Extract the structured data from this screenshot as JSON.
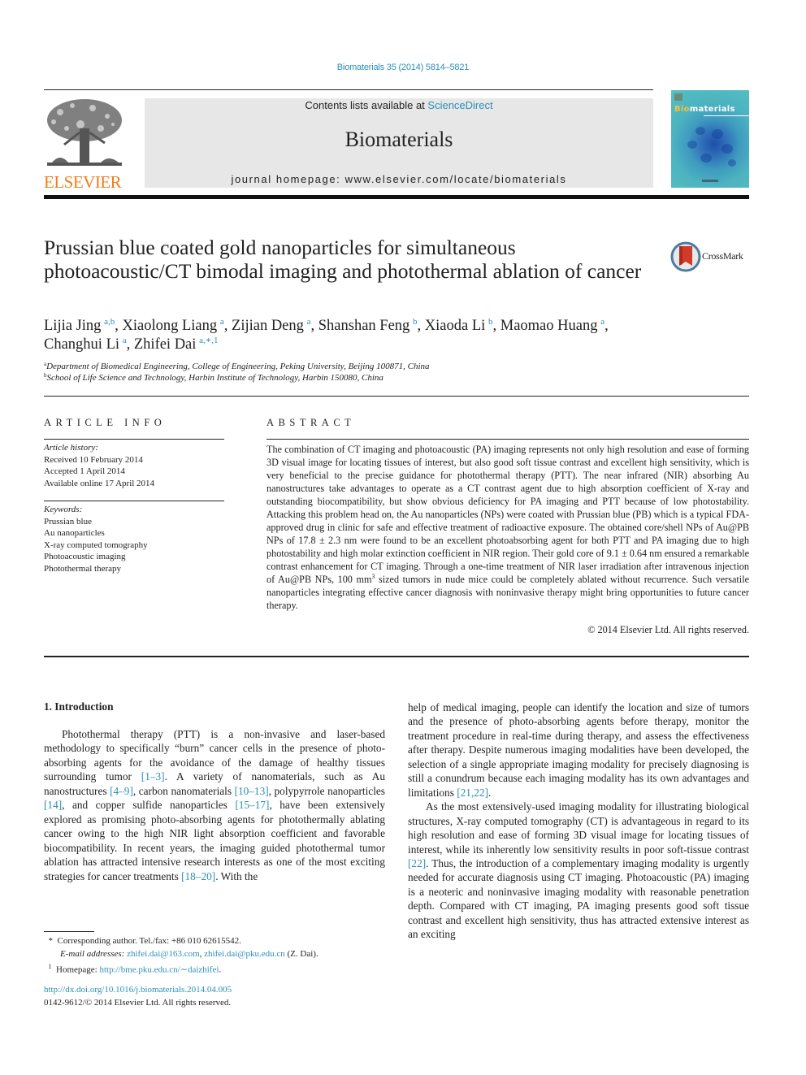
{
  "header": {
    "citation": "Biomaterials 35 (2014) 5814–5821",
    "contents_prefix": "Contents lists available at ",
    "contents_link": "ScienceDirect",
    "journal_name": "Biomaterials",
    "homepage": "journal homepage: www.elsevier.com/locate/biomaterials",
    "publisher_wordmark": "ELSEVIER",
    "cover_title_accent": "Bio",
    "cover_title_rest": "materials",
    "crossmark_label": "CrossMark"
  },
  "article": {
    "title": "Prussian blue coated gold nanoparticles for simultaneous photoacoustic/CT bimodal imaging and photothermal ablation of cancer",
    "authors": [
      {
        "name": "Lijia Jing",
        "sup": "a,b",
        "sep": ", "
      },
      {
        "name": "Xiaolong Liang",
        "sup": "a",
        "sep": ", "
      },
      {
        "name": "Zijian Deng",
        "sup": "a",
        "sep": ", "
      },
      {
        "name": "Shanshan Feng",
        "sup": "b",
        "sep": ", "
      },
      {
        "name": "Xiaoda Li",
        "sup": "b",
        "sep": ", "
      },
      {
        "name": "Maomao Huang",
        "sup": "a",
        "sep": ","
      },
      {
        "name": "Changhui Li",
        "sup": "a",
        "sep": ", "
      },
      {
        "name": "Zhifei Dai",
        "sup": "a,∗,1",
        "sep": ""
      }
    ],
    "affiliations": [
      {
        "mark": "a",
        "text": "Department of Biomedical Engineering, College of Engineering, Peking University, Beijing 100871, China"
      },
      {
        "mark": "b",
        "text": "School of Life Science and Technology, Harbin Institute of Technology, Harbin 150080, China"
      }
    ]
  },
  "article_info": {
    "heading": "ARTICLE INFO",
    "history_label": "Article history:",
    "history": [
      "Received 10 February 2014",
      "Accepted 1 April 2014",
      "Available online 17 April 2014"
    ],
    "keywords_label": "Keywords:",
    "keywords": [
      "Prussian blue",
      "Au nanoparticles",
      "X-ray computed tomography",
      "Photoacoustic imaging",
      "Photothermal therapy"
    ]
  },
  "abstract": {
    "heading": "ABSTRACT",
    "text_before_sup": "The combination of CT imaging and photoacoustic (PA) imaging represents not only high resolution and ease of forming 3D visual image for locating tissues of interest, but also good soft tissue contrast and excellent high sensitivity, which is very beneficial to the precise guidance for photothermal therapy (PTT). The near infrared (NIR) absorbing Au nanostructures take advantages to operate as a CT contrast agent due to high absorption coefficient of X-ray and outstanding biocompatibility, but show obvious deficiency for PA imaging and PTT because of low photostability. Attacking this problem head on, the Au nanoparticles (NPs) were coated with Prussian blue (PB) which is a typical FDA-approved drug in clinic for safe and effective treatment of radioactive exposure. The obtained core/shell NPs of Au@PB NPs of 17.8 ± 2.3 nm were found to be an excellent photoabsorbing agent for both PTT and PA imaging due to high photostability and high molar extinction coefficient in NIR region. Their gold core of 9.1 ± 0.64 nm ensured a remarkable contrast enhancement for CT imaging. Through a one-time treatment of NIR laser irradiation after intravenous injection of Au@PB NPs, 100 mm",
    "sup": "3",
    "text_after_sup": " sized tumors in nude mice could be completely ablated without recurrence. Such versatile nanoparticles integrating effective cancer diagnosis with noninvasive therapy might bring opportunities to future cancer therapy.",
    "copyright": "© 2014 Elsevier Ltd. All rights reserved."
  },
  "introduction": {
    "heading": "1.  Introduction",
    "left_para": [
      {
        "t": "Photothermal therapy (PTT) is a non-invasive and laser-based methodology to specifically “burn” cancer cells in the presence of photo-absorbing agents for the avoidance of the damage of healthy tissues surrounding tumor "
      },
      {
        "ref": "[1–3]"
      },
      {
        "t": ". A variety of nanomaterials, such as Au nanostructures "
      },
      {
        "ref": "[4–9]"
      },
      {
        "t": ", carbon nanomaterials "
      },
      {
        "ref": "[10–13]"
      },
      {
        "t": ", polypyrrole nanoparticles "
      },
      {
        "ref": "[14]"
      },
      {
        "t": ", and copper sulfide nanoparticles "
      },
      {
        "ref": "[15–17]"
      },
      {
        "t": ", have been extensively explored as promising photo-absorbing agents for photothermally ablating cancer owing to the high NIR light absorption coefficient and favorable biocompatibility. In recent years, the imaging guided photothermal tumor ablation has attracted intensive research interests as one of the most exciting strategies for cancer treatments "
      },
      {
        "ref": "[18–20]"
      },
      {
        "t": ". With the"
      }
    ],
    "right_para1": [
      {
        "t": "help of medical imaging, people can identify the location and size of tumors and the presence of photo-absorbing agents before therapy, monitor the treatment procedure in real-time during therapy, and assess the effectiveness after therapy. Despite numerous imaging modalities have been developed, the selection of a single appropriate imaging modality for precisely diagnosing is still a conundrum because each imaging modality has its own advantages and limitations "
      },
      {
        "ref": "[21,22]"
      },
      {
        "t": "."
      }
    ],
    "right_para2": [
      {
        "t": "As the most extensively-used imaging modality for illustrating biological structures, X-ray computed tomography (CT) is advantageous in regard to its high resolution and ease of forming 3D visual image for locating tissues of interest, while its inherently low sensitivity results in poor soft-tissue contrast "
      },
      {
        "ref": "[22]"
      },
      {
        "t": ". Thus, the introduction of a complementary imaging modality is urgently needed for accurate diagnosis using CT imaging. Photoacoustic (PA) imaging is a neoteric and noninvasive imaging modality with reasonable penetration depth. Compared with CT imaging, PA imaging presents good soft tissue contrast and excellent high sensitivity, thus has attracted extensive interest as an exciting"
      }
    ]
  },
  "footnotes": {
    "corresponding_mark": "*",
    "corresponding": "Corresponding author. Tel./fax: +86 010 62615542.",
    "email_label": "E-mail addresses:",
    "email1": "zhifei.dai@163.com",
    "email2": "zhifei.dai@pku.edu.cn",
    "email_suffix": " (Z. Dai).",
    "homepage_mark": "1",
    "homepage_label": "Homepage: ",
    "homepage_url": "http://bme.pku.edu.cn/∼daizhifei",
    "homepage_suffix": "."
  },
  "doi": {
    "url": "http://dx.doi.org/10.1016/j.biomaterials.2014.04.005",
    "issn_line": "0142-9612/© 2014 Elsevier Ltd. All rights reserved."
  },
  "colors": {
    "link": "#2a8fb8",
    "elsevier_orange": "#f07d1a",
    "masthead_bg": "#e7e7e7"
  }
}
